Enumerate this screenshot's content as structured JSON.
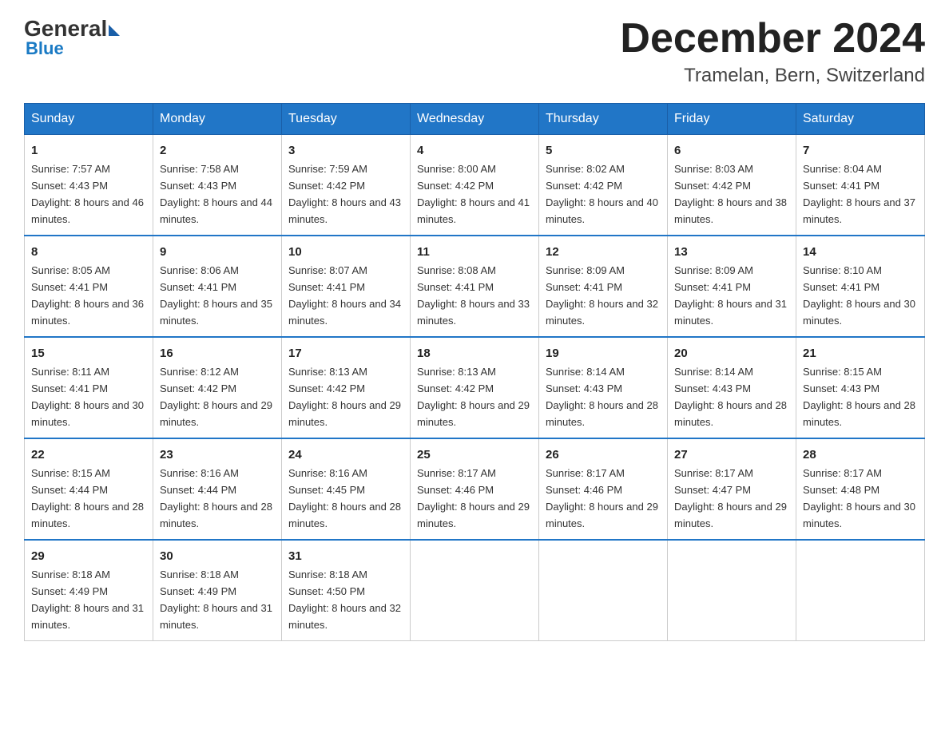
{
  "logo": {
    "general": "General",
    "blue": "Blue"
  },
  "title": "December 2024",
  "subtitle": "Tramelan, Bern, Switzerland",
  "headers": [
    "Sunday",
    "Monday",
    "Tuesday",
    "Wednesday",
    "Thursday",
    "Friday",
    "Saturday"
  ],
  "weeks": [
    [
      {
        "day": "1",
        "sunrise": "7:57 AM",
        "sunset": "4:43 PM",
        "daylight": "8 hours and 46 minutes."
      },
      {
        "day": "2",
        "sunrise": "7:58 AM",
        "sunset": "4:43 PM",
        "daylight": "8 hours and 44 minutes."
      },
      {
        "day": "3",
        "sunrise": "7:59 AM",
        "sunset": "4:42 PM",
        "daylight": "8 hours and 43 minutes."
      },
      {
        "day": "4",
        "sunrise": "8:00 AM",
        "sunset": "4:42 PM",
        "daylight": "8 hours and 41 minutes."
      },
      {
        "day": "5",
        "sunrise": "8:02 AM",
        "sunset": "4:42 PM",
        "daylight": "8 hours and 40 minutes."
      },
      {
        "day": "6",
        "sunrise": "8:03 AM",
        "sunset": "4:42 PM",
        "daylight": "8 hours and 38 minutes."
      },
      {
        "day": "7",
        "sunrise": "8:04 AM",
        "sunset": "4:41 PM",
        "daylight": "8 hours and 37 minutes."
      }
    ],
    [
      {
        "day": "8",
        "sunrise": "8:05 AM",
        "sunset": "4:41 PM",
        "daylight": "8 hours and 36 minutes."
      },
      {
        "day": "9",
        "sunrise": "8:06 AM",
        "sunset": "4:41 PM",
        "daylight": "8 hours and 35 minutes."
      },
      {
        "day": "10",
        "sunrise": "8:07 AM",
        "sunset": "4:41 PM",
        "daylight": "8 hours and 34 minutes."
      },
      {
        "day": "11",
        "sunrise": "8:08 AM",
        "sunset": "4:41 PM",
        "daylight": "8 hours and 33 minutes."
      },
      {
        "day": "12",
        "sunrise": "8:09 AM",
        "sunset": "4:41 PM",
        "daylight": "8 hours and 32 minutes."
      },
      {
        "day": "13",
        "sunrise": "8:09 AM",
        "sunset": "4:41 PM",
        "daylight": "8 hours and 31 minutes."
      },
      {
        "day": "14",
        "sunrise": "8:10 AM",
        "sunset": "4:41 PM",
        "daylight": "8 hours and 30 minutes."
      }
    ],
    [
      {
        "day": "15",
        "sunrise": "8:11 AM",
        "sunset": "4:41 PM",
        "daylight": "8 hours and 30 minutes."
      },
      {
        "day": "16",
        "sunrise": "8:12 AM",
        "sunset": "4:42 PM",
        "daylight": "8 hours and 29 minutes."
      },
      {
        "day": "17",
        "sunrise": "8:13 AM",
        "sunset": "4:42 PM",
        "daylight": "8 hours and 29 minutes."
      },
      {
        "day": "18",
        "sunrise": "8:13 AM",
        "sunset": "4:42 PM",
        "daylight": "8 hours and 29 minutes."
      },
      {
        "day": "19",
        "sunrise": "8:14 AM",
        "sunset": "4:43 PM",
        "daylight": "8 hours and 28 minutes."
      },
      {
        "day": "20",
        "sunrise": "8:14 AM",
        "sunset": "4:43 PM",
        "daylight": "8 hours and 28 minutes."
      },
      {
        "day": "21",
        "sunrise": "8:15 AM",
        "sunset": "4:43 PM",
        "daylight": "8 hours and 28 minutes."
      }
    ],
    [
      {
        "day": "22",
        "sunrise": "8:15 AM",
        "sunset": "4:44 PM",
        "daylight": "8 hours and 28 minutes."
      },
      {
        "day": "23",
        "sunrise": "8:16 AM",
        "sunset": "4:44 PM",
        "daylight": "8 hours and 28 minutes."
      },
      {
        "day": "24",
        "sunrise": "8:16 AM",
        "sunset": "4:45 PM",
        "daylight": "8 hours and 28 minutes."
      },
      {
        "day": "25",
        "sunrise": "8:17 AM",
        "sunset": "4:46 PM",
        "daylight": "8 hours and 29 minutes."
      },
      {
        "day": "26",
        "sunrise": "8:17 AM",
        "sunset": "4:46 PM",
        "daylight": "8 hours and 29 minutes."
      },
      {
        "day": "27",
        "sunrise": "8:17 AM",
        "sunset": "4:47 PM",
        "daylight": "8 hours and 29 minutes."
      },
      {
        "day": "28",
        "sunrise": "8:17 AM",
        "sunset": "4:48 PM",
        "daylight": "8 hours and 30 minutes."
      }
    ],
    [
      {
        "day": "29",
        "sunrise": "8:18 AM",
        "sunset": "4:49 PM",
        "daylight": "8 hours and 31 minutes."
      },
      {
        "day": "30",
        "sunrise": "8:18 AM",
        "sunset": "4:49 PM",
        "daylight": "8 hours and 31 minutes."
      },
      {
        "day": "31",
        "sunrise": "8:18 AM",
        "sunset": "4:50 PM",
        "daylight": "8 hours and 32 minutes."
      },
      null,
      null,
      null,
      null
    ]
  ]
}
